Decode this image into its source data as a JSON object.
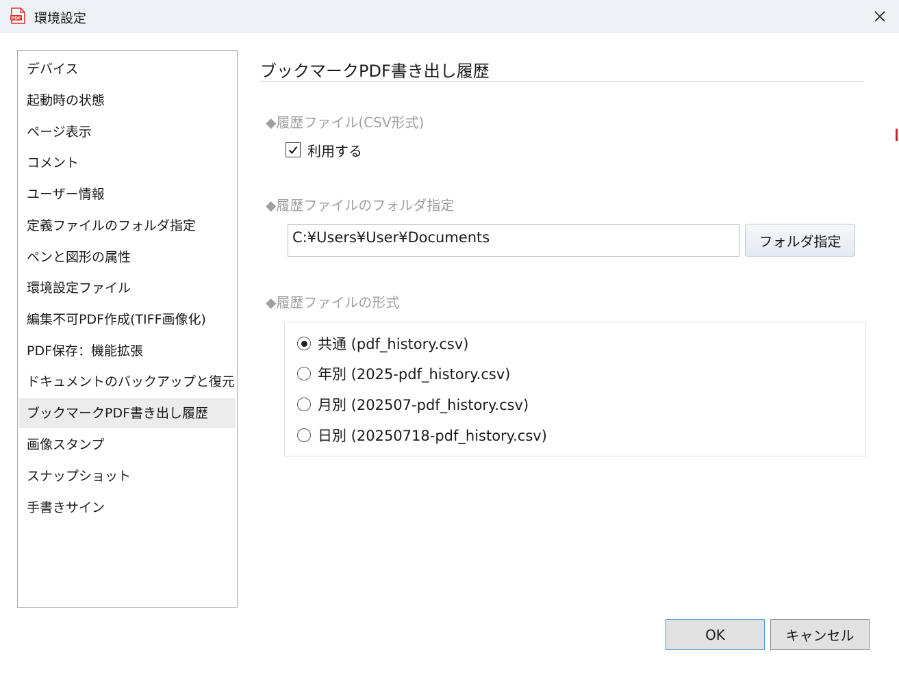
{
  "window": {
    "title": "環境設定",
    "app_icon": "pdf-app-icon",
    "close_icon": "close-icon"
  },
  "sidebar": {
    "items": [
      {
        "label": "デバイス"
      },
      {
        "label": "起動時の状態"
      },
      {
        "label": "ページ表示"
      },
      {
        "label": "コメント"
      },
      {
        "label": "ユーザー情報"
      },
      {
        "label": "定義ファイルのフォルダ指定"
      },
      {
        "label": "ペンと図形の属性"
      },
      {
        "label": "環境設定ファイル"
      },
      {
        "label": "編集不可PDF作成(TIFF画像化)"
      },
      {
        "label": "PDF保存：機能拡張"
      },
      {
        "label": "ドキュメントのバックアップと復元"
      },
      {
        "label": "ブックマークPDF書き出し履歴",
        "selected": true
      },
      {
        "label": "画像スタンプ"
      },
      {
        "label": "スナップショット"
      },
      {
        "label": "手書きサイン"
      }
    ]
  },
  "main": {
    "title": "ブックマークPDF書き出し履歴",
    "csv_group": {
      "label": "◆履歴ファイル(CSV形式)",
      "checkbox_label": "利用する",
      "checked": true
    },
    "folder_group": {
      "label": "◆履歴ファイルのフォルダ指定",
      "path_value": "C:¥Users¥User¥Documents",
      "button_label": "フォルダ指定"
    },
    "format_group": {
      "label": "◆履歴ファイルの形式",
      "options": [
        {
          "label": "共通 (pdf_history.csv)",
          "selected": true
        },
        {
          "label": "年別 (2025-pdf_history.csv)",
          "selected": false
        },
        {
          "label": "月別 (202507-pdf_history.csv)",
          "selected": false
        },
        {
          "label": "日別 (20250718-pdf_history.csv)",
          "selected": false
        }
      ]
    }
  },
  "footer": {
    "ok_label": "OK",
    "cancel_label": "キャンセル"
  },
  "colors": {
    "titlebar_bg": "#eef2f7",
    "selected_item_bg": "#ececec",
    "group_label": "#a0a0a0",
    "ok_border": "#4e8fd0",
    "icon_red": "#d9342b"
  }
}
